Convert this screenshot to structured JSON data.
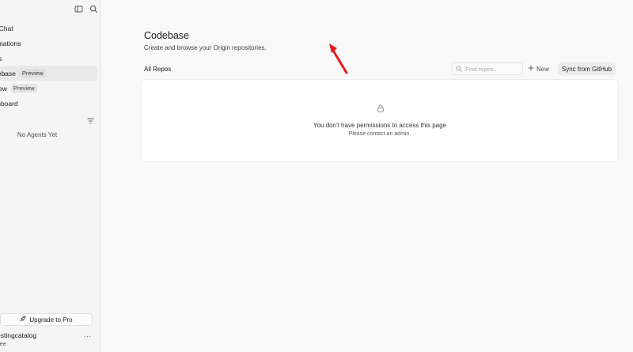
{
  "sidebar": {
    "items": [
      {
        "label": "v Chat",
        "badge": ""
      },
      {
        "label": "omations",
        "badge": ""
      },
      {
        "label": "ws",
        "badge": ""
      },
      {
        "label": "debase",
        "badge": "Preview"
      },
      {
        "label": "view",
        "badge": "Preview"
      },
      {
        "label": "shboard",
        "badge": ""
      }
    ],
    "empty_agents": "No Agents Yet",
    "upgrade_label": "Upgrade to Pro",
    "user_name": "estingcatalog",
    "user_plan": "ree",
    "user_more": "···"
  },
  "main": {
    "title": "Codebase",
    "subtitle": "Create and browse your Origin repositories.",
    "section_label": "All Repos",
    "search_placeholder": "Find repos...",
    "new_label": "New",
    "sync_label": "Sync from GitHub",
    "permission_message": "You don't have permissions to access this page",
    "admin_message": "Please contact an admin."
  },
  "colors": {
    "annotation_arrow": "#e31b1b",
    "sidebar_bg": "#f5f5f5",
    "main_bg": "#f8f8f8",
    "active_item_bg": "#e9e9e9"
  },
  "icons": [
    "sidebar-toggle-icon",
    "search-icon",
    "filter-icon",
    "upgrade-icon",
    "lock-icon",
    "plus-icon",
    "more-icon"
  ]
}
